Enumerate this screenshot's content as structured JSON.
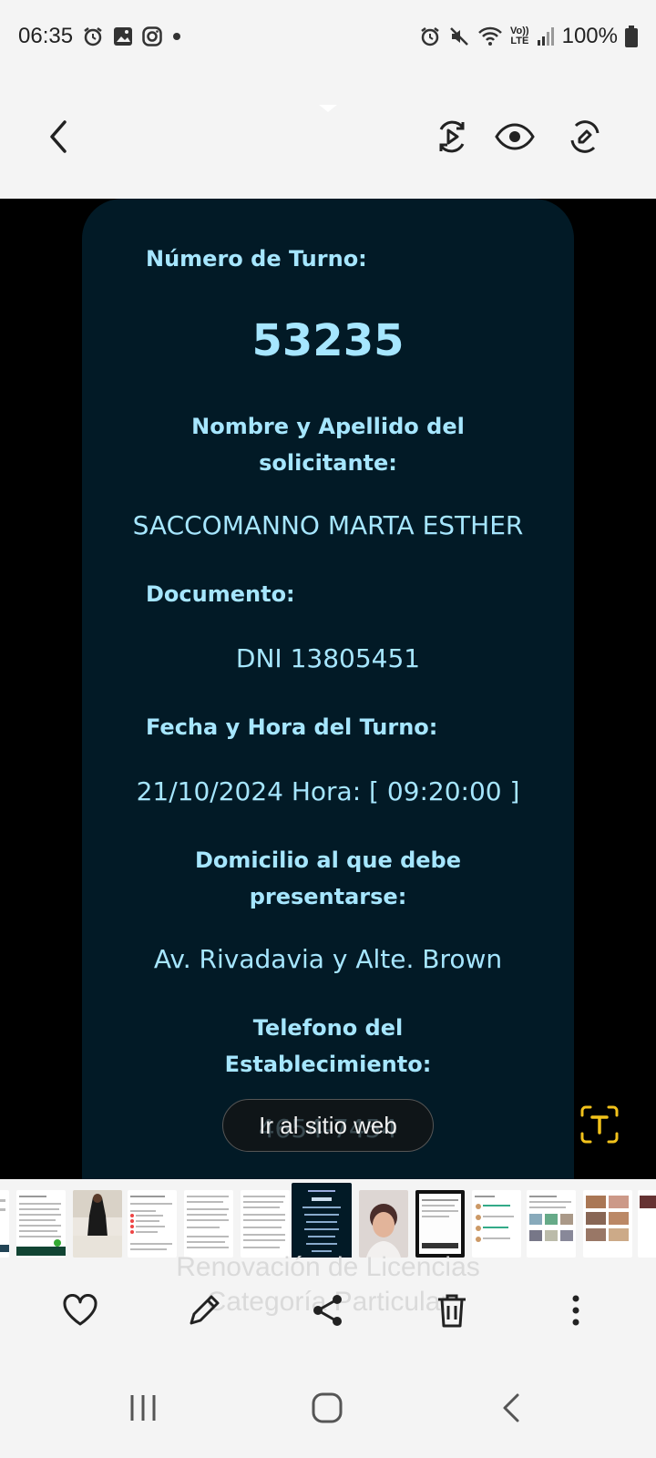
{
  "status_bar": {
    "time": "06:35",
    "battery": "100%",
    "network": "LTE",
    "volte": "Vo))"
  },
  "card": {
    "turn_label": "Número de Turno:",
    "turn_number": "53235",
    "name_label_line1": "Nombre y Apellido del",
    "name_label_line2": "solicitante:",
    "name_value": "SACCOMANNO MARTA ESTHER",
    "doc_label": "Documento:",
    "doc_value": "DNI 13805451",
    "date_label": "Fecha y Hora del Turno:",
    "date_value": "21/10/2024 Hora: [ 09:20:00 ]",
    "address_label_line1": "Domicilio al que debe",
    "address_label_line2": "presentarse:",
    "address_value": "Av. Rivadavia y Alte. Brown",
    "phone_label_line1": "Telefono del",
    "phone_label_line2": "Establecimiento:",
    "phone_value": "4654-7454"
  },
  "web_button_label": "Ir al sitio web",
  "ghost_caption": {
    "line1": "Renovación de Licencias",
    "line2": "Categoría Particular"
  },
  "colors": {
    "card_bg": "#021a26",
    "card_text": "#a6e6ff",
    "chrome_bg": "#f4f4f4",
    "ocr_accent": "#f2c21b"
  }
}
